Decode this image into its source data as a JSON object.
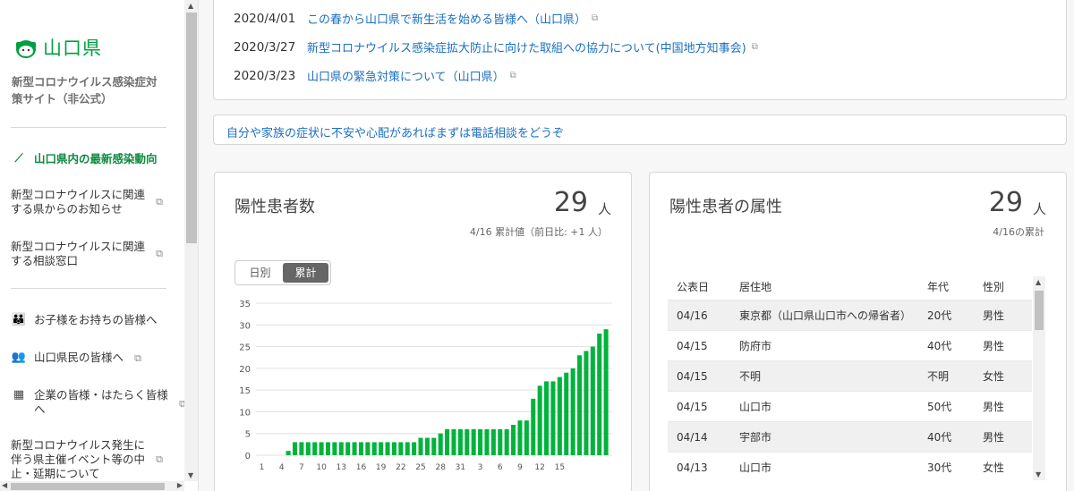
{
  "sidebar": {
    "logo": "山口県",
    "subtitle": "新型コロナウイルス感染症対策サイト（非公式）",
    "items": [
      {
        "label": "山口県内の最新感染動向",
        "active": true,
        "icon": "trend-icon"
      },
      {
        "label": "新型コロナウイルスに関連する県からのお知らせ",
        "external": true
      },
      {
        "label": "新型コロナウイルスに関連する相談窓口",
        "external": true
      },
      {
        "label": "お子様をお持ちの皆様へ",
        "icon": "parent-child-icon"
      },
      {
        "label": "山口県民の皆様へ",
        "icon": "people-icon",
        "external": true
      },
      {
        "label": "企業の皆様・はたらく皆様へ",
        "icon": "building-icon",
        "external": true
      },
      {
        "label": "新型コロナウイルス発生に伴う県主催イベント等の中止・延期について",
        "external": true
      }
    ]
  },
  "news": [
    {
      "date": "2020/4/01",
      "title": "この春から山口県で新生活を始める皆様へ（山口県）"
    },
    {
      "date": "2020/3/27",
      "title": "新型コロナウイルス感染症拡大防止に向けた取組への協力について(中国地方知事会)"
    },
    {
      "date": "2020/3/23",
      "title": "山口県の緊急対策について（山口県）"
    }
  ],
  "banner": "自分や家族の症状に不安や心配があればまずは電話相談をどうぞ",
  "positive": {
    "title": "陽性患者数",
    "value": "29",
    "unit": "人",
    "note": "4/16 累計値（前日比: +1 人）",
    "toggle": [
      "日別",
      "累計"
    ]
  },
  "attributes": {
    "title": "陽性患者の属性",
    "value": "29",
    "unit": "人",
    "note": "4/16の累計",
    "headers": [
      "公表日",
      "居住地",
      "年代",
      "性別"
    ],
    "rows": [
      [
        "04/16",
        "東京都（山口県山口市への帰省者）",
        "20代",
        "男性"
      ],
      [
        "04/15",
        "防府市",
        "40代",
        "男性"
      ],
      [
        "04/15",
        "不明",
        "不明",
        "女性"
      ],
      [
        "04/15",
        "山口市",
        "50代",
        "男性"
      ],
      [
        "04/14",
        "宇部市",
        "40代",
        "男性"
      ],
      [
        "04/13",
        "山口市",
        "30代",
        "女性"
      ]
    ]
  },
  "colors": {
    "accent": "#00a040",
    "bar": "#00b33c",
    "link": "#1a6fc1"
  },
  "chart_data": {
    "type": "bar",
    "ylim": [
      0,
      35
    ],
    "yticks": [
      0,
      5,
      10,
      15,
      20,
      25,
      30,
      35
    ],
    "x_tick_labels": [
      "1",
      "4",
      "7",
      "10",
      "13",
      "16",
      "19",
      "22",
      "25",
      "28",
      "31",
      "3",
      "6",
      "9",
      "12",
      "15"
    ],
    "categories": [
      "3/1",
      "3/2",
      "3/3",
      "3/4",
      "3/5",
      "3/6",
      "3/7",
      "3/8",
      "3/9",
      "3/10",
      "3/11",
      "3/12",
      "3/13",
      "3/14",
      "3/15",
      "3/16",
      "3/17",
      "3/18",
      "3/19",
      "3/20",
      "3/21",
      "3/22",
      "3/23",
      "3/24",
      "3/25",
      "3/26",
      "3/27",
      "3/28",
      "3/29",
      "3/30",
      "3/31",
      "4/1",
      "4/2",
      "4/3",
      "4/4",
      "4/5",
      "4/6",
      "4/7",
      "4/8",
      "4/9",
      "4/10",
      "4/11",
      "4/12",
      "4/13",
      "4/14",
      "4/15",
      "4/16"
    ],
    "values": [
      0,
      0,
      0,
      0,
      1,
      3,
      3,
      3,
      3,
      3,
      3,
      3,
      3,
      3,
      3,
      3,
      3,
      3,
      3,
      3,
      3,
      3,
      3,
      3,
      4,
      4,
      4,
      5,
      6,
      6,
      6,
      6,
      6,
      6,
      6,
      6,
      6,
      6,
      7,
      8,
      8,
      13,
      16,
      17,
      17,
      18,
      19,
      20,
      23,
      24,
      25,
      28,
      29
    ],
    "grid": true
  }
}
